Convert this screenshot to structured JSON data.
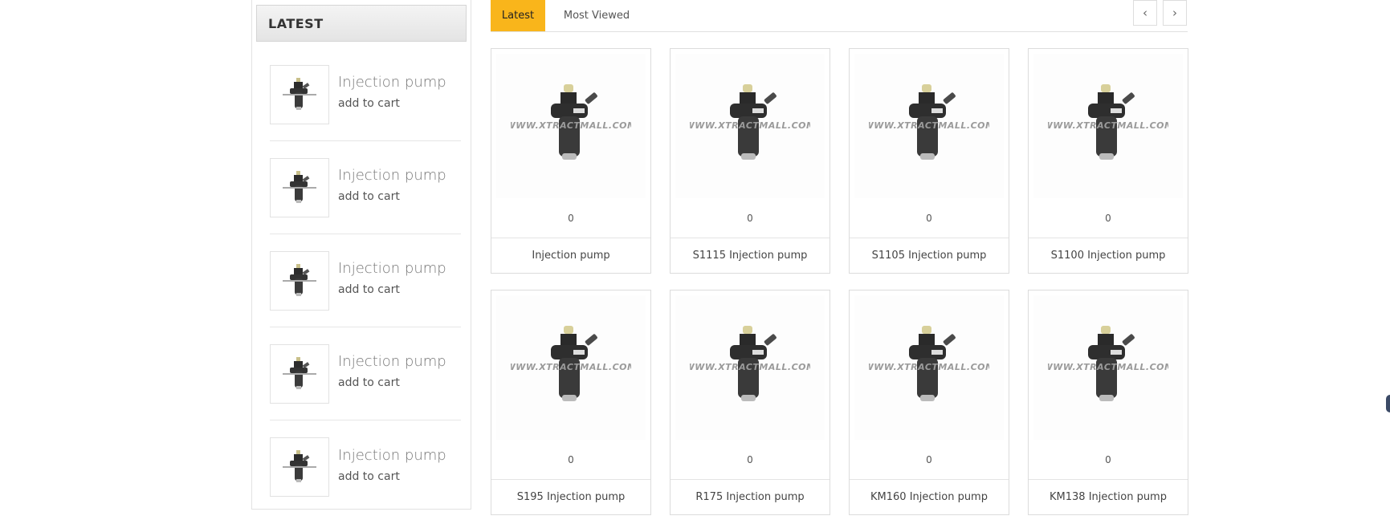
{
  "sidebar": {
    "heading": "LATEST",
    "items": [
      {
        "name": "Injection pump",
        "cart": "add to cart"
      },
      {
        "name": "Injection pump",
        "cart": "add to cart"
      },
      {
        "name": "Injection pump",
        "cart": "add to cart"
      },
      {
        "name": "Injection pump",
        "cart": "add to cart"
      },
      {
        "name": "Injection pump",
        "cart": "add to cart"
      }
    ]
  },
  "tabs": {
    "active": "Latest",
    "other": "Most Viewed",
    "prev_icon": "chevron-left-icon",
    "next_icon": "chevron-right-icon"
  },
  "products": [
    {
      "price": "0",
      "name": "Injection pump"
    },
    {
      "price": "0",
      "name": "S1115 Injection pump"
    },
    {
      "price": "0",
      "name": "S1105 Injection pump"
    },
    {
      "price": "0",
      "name": "S1100 Injection pump"
    },
    {
      "price": "0",
      "name": "S195 Injection pump"
    },
    {
      "price": "0",
      "name": "R175 Injection pump"
    },
    {
      "price": "0",
      "name": "KM160 Injection pump"
    },
    {
      "price": "0",
      "name": "KM138 Injection pump"
    }
  ],
  "watermark": "WWW.XTRACTMALL.COM",
  "colors": {
    "accent": "#f9b51b",
    "border": "#dcdcdc"
  }
}
